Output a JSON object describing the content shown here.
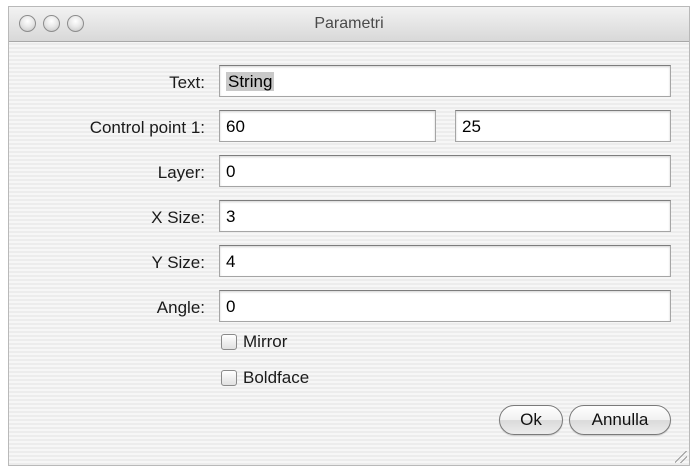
{
  "window": {
    "title": "Parametri"
  },
  "form": {
    "text_label": "Text:",
    "text_value": "String",
    "control_point_label": "Control point 1:",
    "control_point_x": "60",
    "control_point_y": "25",
    "layer_label": "Layer:",
    "layer_value": "0",
    "xsize_label": "X Size:",
    "xsize_value": "3",
    "ysize_label": "Y Size:",
    "ysize_value": "4",
    "angle_label": "Angle:",
    "angle_value": "0"
  },
  "options": {
    "mirror_label": "Mirror",
    "mirror_checked": false,
    "boldface_label": "Boldface",
    "boldface_checked": false
  },
  "buttons": {
    "ok_label": "Ok",
    "cancel_label": "Annulla"
  }
}
